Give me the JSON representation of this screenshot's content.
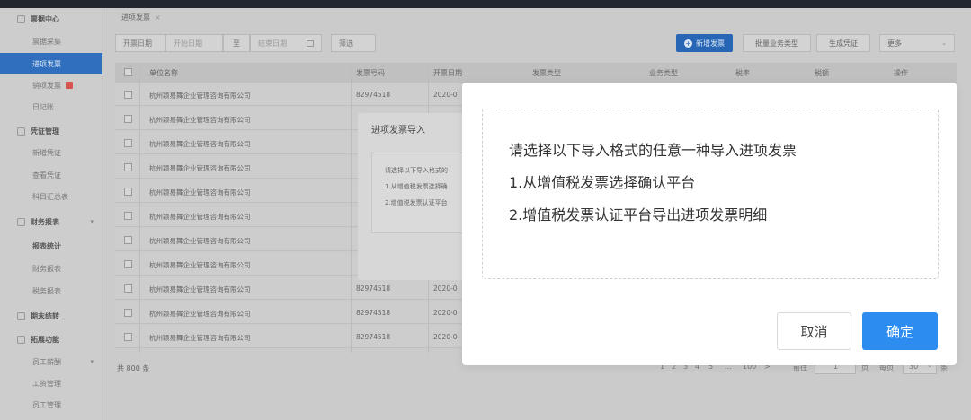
{
  "sidebar": {
    "items": [
      {
        "label": "票据中心",
        "kind": "group"
      },
      {
        "label": "票据采集",
        "kind": "sub"
      },
      {
        "label": "进项发票",
        "kind": "active"
      },
      {
        "label": "销项发票",
        "kind": "sub",
        "badge": true
      },
      {
        "label": "日记账",
        "kind": "sub"
      },
      {
        "label": "凭证管理",
        "kind": "group"
      },
      {
        "label": "新增凭证",
        "kind": "sub"
      },
      {
        "label": "查看凭证",
        "kind": "sub"
      },
      {
        "label": "科目汇总表",
        "kind": "sub"
      },
      {
        "label": "财务报表",
        "kind": "group",
        "caret": true
      },
      {
        "label": "报表统计",
        "kind": "bold"
      },
      {
        "label": "财务报表",
        "kind": "sub"
      },
      {
        "label": "税务报表",
        "kind": "sub"
      },
      {
        "label": "期末结转",
        "kind": "group"
      },
      {
        "label": "拓展功能",
        "kind": "group"
      },
      {
        "label": "员工薪酬",
        "kind": "sub",
        "caret": true
      },
      {
        "label": "工资管理",
        "kind": "sub"
      },
      {
        "label": "员工管理",
        "kind": "sub"
      }
    ]
  },
  "page_tab": {
    "label": "进项发票",
    "close": "×"
  },
  "filters": {
    "date_label": "开票日期",
    "start_placeholder": "开始日期",
    "to": "至",
    "end_placeholder": "结束日期",
    "filter_button": "筛选"
  },
  "toolbar": {
    "add_invoice": "新增发票",
    "batch_business_type": "批量业务类型",
    "generate_voucher": "生成凭证",
    "more": "更多"
  },
  "table": {
    "headers": [
      "单位名称",
      "发票号码",
      "开票日期",
      "发票类型",
      "业务类型",
      "税率",
      "税额",
      "操作"
    ],
    "rows": [
      {
        "company": "杭州颖易舞企业管理咨询有限公司",
        "number": "82974518",
        "date": "2020-0"
      },
      {
        "company": "杭州颖易舞企业管理咨询有限公司",
        "number": "",
        "date": ""
      },
      {
        "company": "杭州颖易舞企业管理咨询有限公司",
        "number": "",
        "date": ""
      },
      {
        "company": "杭州颖易舞企业管理咨询有限公司",
        "number": "",
        "date": ""
      },
      {
        "company": "杭州颖易舞企业管理咨询有限公司",
        "number": "",
        "date": ""
      },
      {
        "company": "杭州颖易舞企业管理咨询有限公司",
        "number": "",
        "date": ""
      },
      {
        "company": "杭州颖易舞企业管理咨询有限公司",
        "number": "",
        "date": ""
      },
      {
        "company": "杭州颖易舞企业管理咨询有限公司",
        "number": "",
        "date": ""
      },
      {
        "company": "杭州颖易舞企业管理咨询有限公司",
        "number": "82974518",
        "date": "2020-0"
      },
      {
        "company": "杭州颖易舞企业管理咨询有限公司",
        "number": "82974518",
        "date": "2020-0"
      },
      {
        "company": "杭州颖易舞企业管理咨询有限公司",
        "number": "82974518",
        "date": "2020-0"
      }
    ]
  },
  "footer": {
    "total": "共 800 条",
    "pages": [
      "1",
      "2",
      "3",
      "4",
      "5",
      "...",
      "100",
      ">"
    ],
    "goto_label": "前往",
    "goto_value": "1",
    "goto_suffix": "页",
    "per_page_label": "每页",
    "per_page_value": "30",
    "per_page_suffix": "条"
  },
  "import_dialog_back": {
    "title": "进项发票导入",
    "lines": [
      "请选择以下导入格式的",
      "1.从增值税发票选择确",
      "2.增值税发票认证平台"
    ]
  },
  "import_dialog": {
    "line1": "请选择以下导入格式的任意一种导入进项发票",
    "line2": "1.从增值税发票选择确认平台",
    "line3": "2.增值税发票认证平台导出进项发票明细",
    "cancel": "取消",
    "confirm": "确定"
  },
  "colors": {
    "primary": "#2d8cf0",
    "sidebar_active": "#2f6fbd",
    "topbar": "#23282f"
  }
}
